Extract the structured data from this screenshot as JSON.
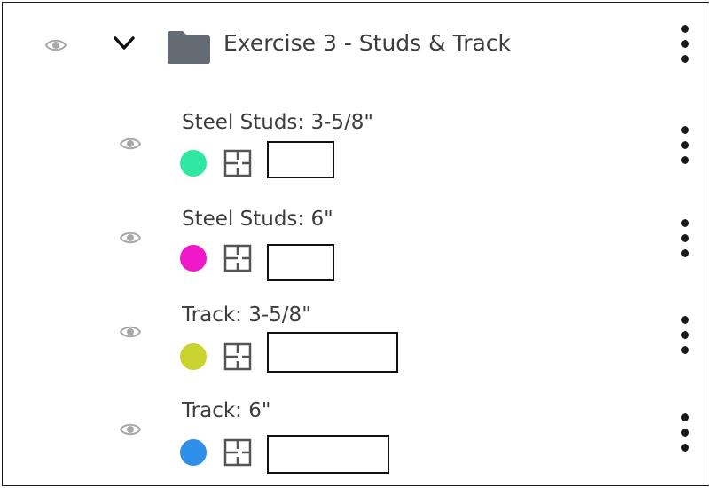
{
  "group": {
    "title": "Exercise 3 - Studs & Track",
    "icons": {
      "visibility": "eye-icon",
      "expand": "chevron-down-icon",
      "folder": "folder-icon",
      "menu": "more-vertical-icon"
    }
  },
  "layers": [
    {
      "name": "Steel Studs: 3-5/8\"",
      "color": "#2ee8a0"
    },
    {
      "name": "Steel Studs: 6\"",
      "color": "#f018c8"
    },
    {
      "name": "Track: 3-5/8\"",
      "color": "#c9d22e"
    },
    {
      "name": "Track: 6\"",
      "color": "#2f8fe8"
    }
  ]
}
